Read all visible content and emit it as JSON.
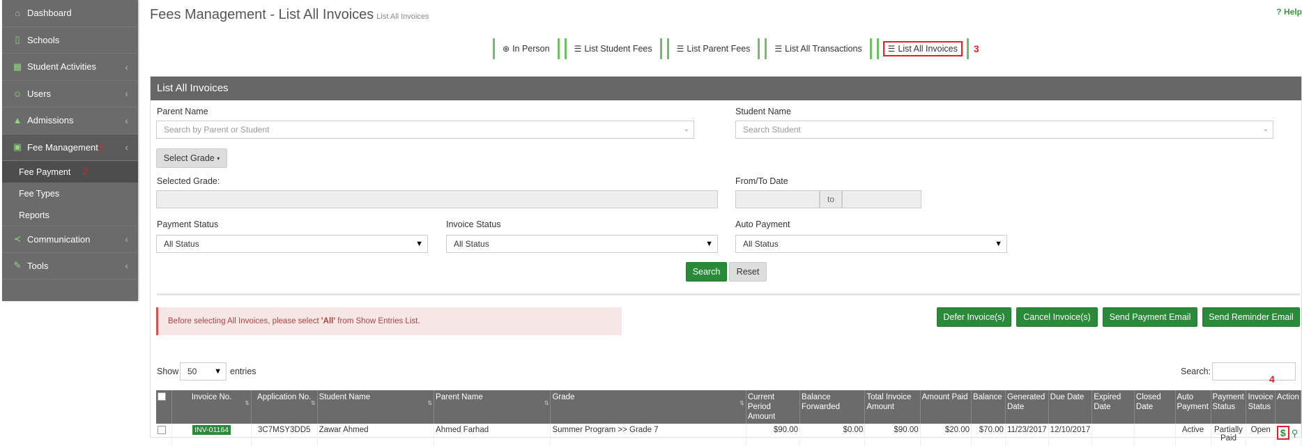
{
  "sidebar": {
    "items": [
      {
        "label": "Dashboard",
        "icon": "home-icon"
      },
      {
        "label": "Schools",
        "icon": "school-icon"
      },
      {
        "label": "Student Activities",
        "icon": "calendar-icon"
      },
      {
        "label": "Users",
        "icon": "users-icon"
      },
      {
        "label": "Admissions",
        "icon": "graduation-cap-icon"
      },
      {
        "label": "Fee Management",
        "icon": "fee-icon",
        "marker": "1"
      },
      {
        "label": "Communication",
        "icon": "share-icon"
      },
      {
        "label": "Tools",
        "icon": "wrench-icon"
      }
    ],
    "sub_items": [
      {
        "label": "Fee Payment",
        "marker": "2"
      },
      {
        "label": "Fee Types"
      },
      {
        "label": "Reports"
      }
    ]
  },
  "header": {
    "title": "Fees Management - List All Invoices",
    "subtitle": "List All Invoices",
    "help": "Help"
  },
  "tabs": [
    {
      "label": "In Person",
      "icon": "plus-circle-icon"
    },
    {
      "label": "List Student Fees",
      "icon": "list-icon"
    },
    {
      "label": "List Parent Fees",
      "icon": "list-icon"
    },
    {
      "label": "List All Transactions",
      "icon": "list-icon"
    },
    {
      "label": "List All Invoices",
      "icon": "list-icon",
      "marker": "3"
    }
  ],
  "panel": {
    "title": "List All Invoices",
    "parent_name_label": "Parent Name",
    "parent_name_placeholder": "Search by Parent or Student",
    "student_name_label": "Student Name",
    "student_name_placeholder": "Search Student",
    "select_grade": "Select Grade",
    "selected_grade_label": "Selected Grade:",
    "from_to_label": "From/To Date",
    "to": "to",
    "payment_status_label": "Payment Status",
    "payment_status_value": "All Status",
    "invoice_status_label": "Invoice Status",
    "invoice_status_value": "All Status",
    "auto_payment_label": "Auto Payment",
    "auto_payment_value": "All Status",
    "search_btn": "Search",
    "reset_btn": "Reset",
    "alert_pre": "Before selecting All Invoices, please select ",
    "alert_bold": "'All'",
    "alert_post": " from Show Entries List.",
    "defer_btn": "Defer Invoice(s)",
    "cancel_btn": "Cancel Invoice(s)",
    "payment_email_btn": "Send Payment Email",
    "reminder_email_btn": "Send Reminder Email",
    "show": "Show",
    "entries_value": "50",
    "entries": "entries",
    "search_label": "Search:",
    "action_marker": "4"
  },
  "table": {
    "headers": [
      "Invoice No.",
      "Application No.",
      "Student Name",
      "Parent Name",
      "Grade",
      "Current Period Amount",
      "Balance Forwarded",
      "Total Invoice Amount",
      "Amount Paid",
      "Balance",
      "Generated Date",
      "Due Date",
      "Expired Date",
      "Closed Date",
      "Auto Payment",
      "Payment Status",
      "Invoice Status",
      "Action"
    ],
    "rows": [
      {
        "invoice": "INV-01164",
        "application": "3C7MSY3DD5",
        "student": "Zawar Ahmed",
        "parent": "Ahmed Farhad",
        "grade": "Summer Program >> Grade 7",
        "current": "$90.00",
        "forwarded": "$0.00",
        "total": "$90.00",
        "paid": "$20.00",
        "balance": "$70.00",
        "generated": "11/23/2017",
        "due": "12/10/2017",
        "expired": "",
        "closed": "",
        "auto": "Active",
        "payment_status": "Partially Paid",
        "invoice_status": "Open"
      }
    ]
  },
  "colors": {
    "accent": "#2a8a3a",
    "marker": "#e41e26",
    "sidebar": "#6b6b6b"
  }
}
